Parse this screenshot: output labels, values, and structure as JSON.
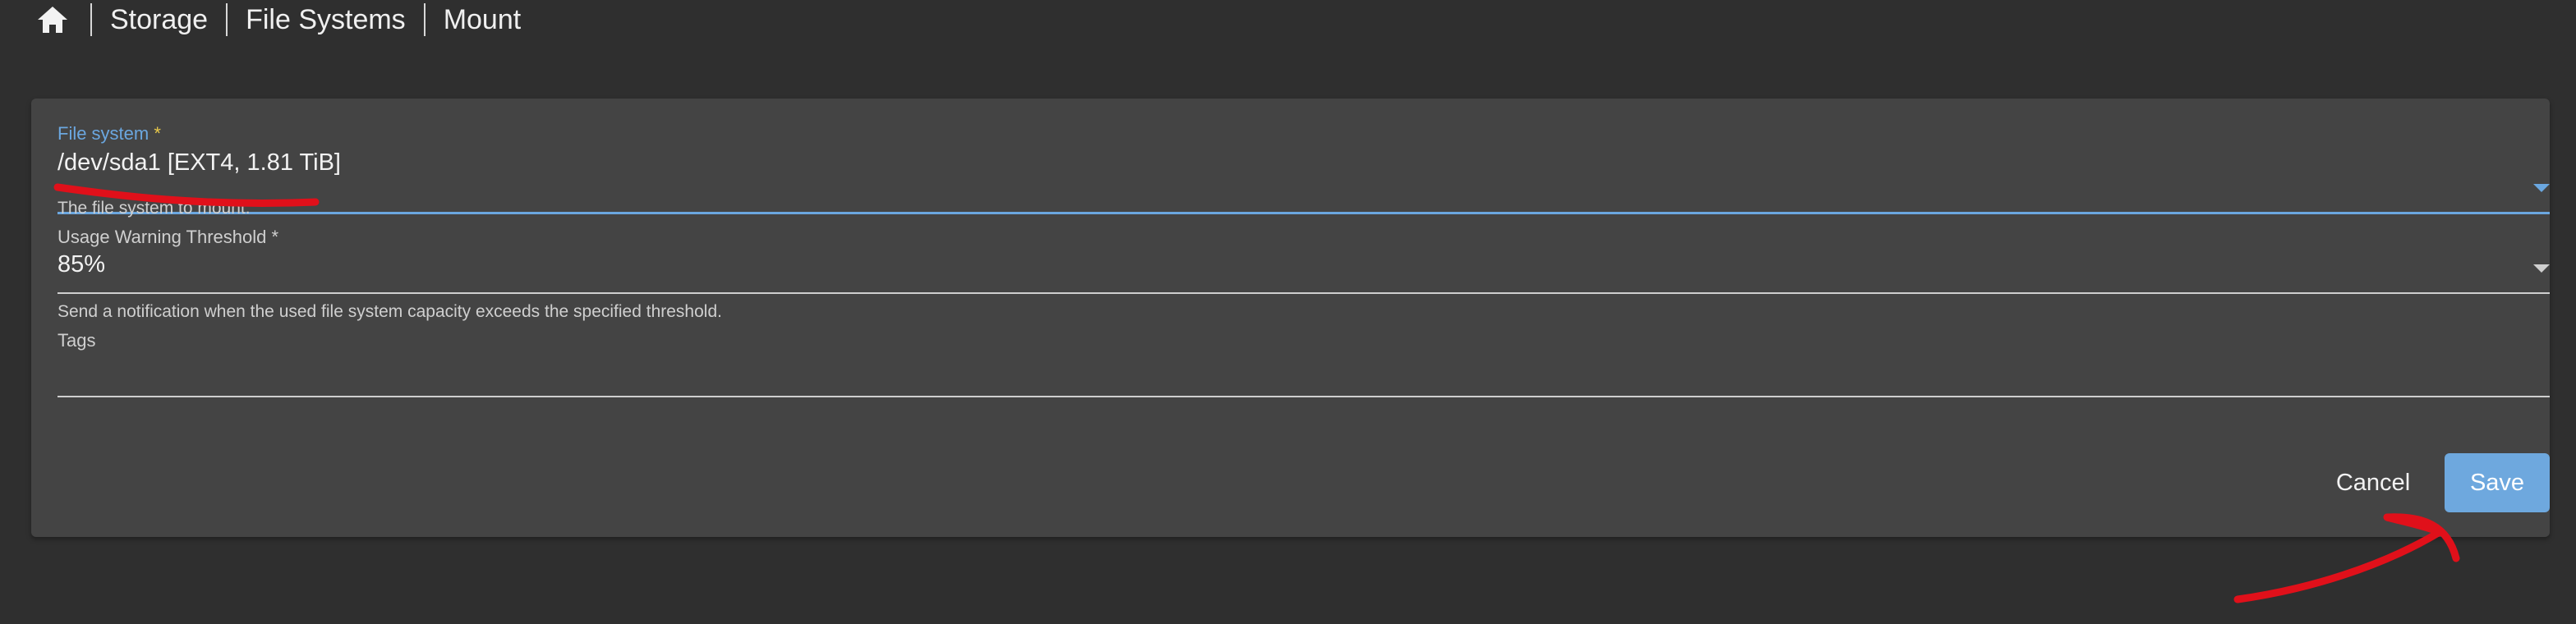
{
  "breadcrumb": {
    "home_icon": "home-icon",
    "items": [
      "Storage",
      "File Systems",
      "Mount"
    ]
  },
  "form": {
    "file_system": {
      "label": "File system",
      "required_mark": "*",
      "value": "/dev/sda1 [EXT4, 1.81 TiB]",
      "helper": "The file system to mount."
    },
    "usage_warning": {
      "label": "Usage Warning Threshold",
      "required_mark": "*",
      "value": "85%",
      "helper": "Send a notification when the used file system capacity exceeds the specified threshold."
    },
    "tags": {
      "label": "Tags",
      "value": ""
    }
  },
  "actions": {
    "cancel_label": "Cancel",
    "save_label": "Save"
  },
  "colors": {
    "background": "#2f2f2f",
    "card": "#444444",
    "accent": "#6ba7e0",
    "save_button": "#6ea8de",
    "annotation": "#e0101a",
    "required_star": "#e8c84a"
  }
}
